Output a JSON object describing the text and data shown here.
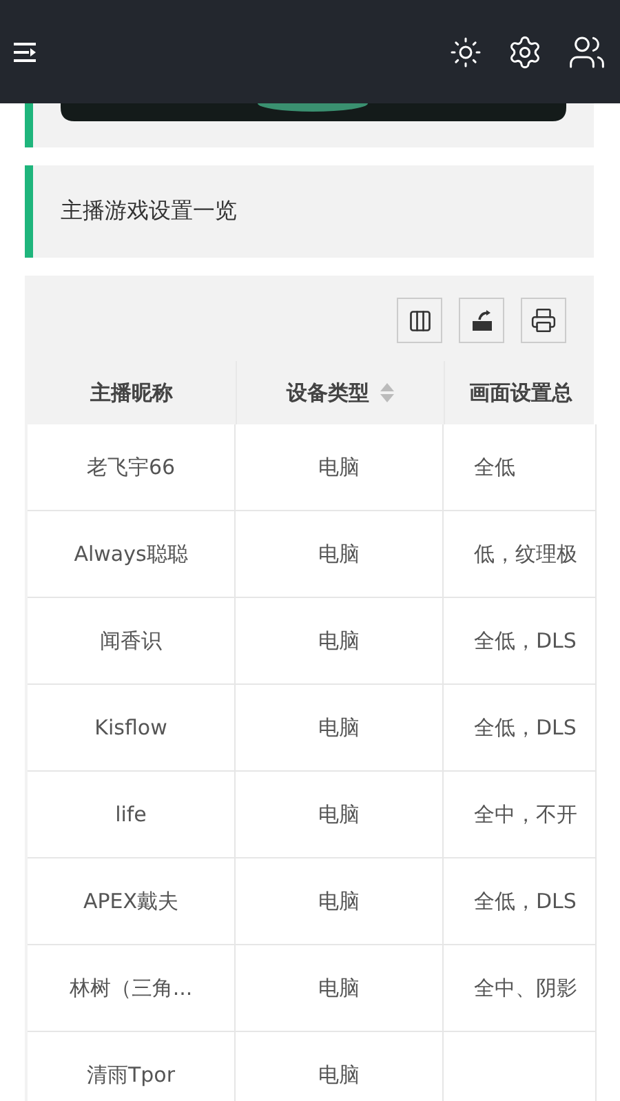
{
  "section": {
    "title": "主播游戏设置一览"
  },
  "table": {
    "columns": [
      {
        "label": "主播昵称",
        "sortable": false
      },
      {
        "label": "设备类型",
        "sortable": true
      },
      {
        "label": "画面设置总",
        "sortable": false
      }
    ],
    "rows": [
      [
        "老飞宇66",
        "电脑",
        "全低"
      ],
      [
        "Always聪聪",
        "电脑",
        "低，纹理极"
      ],
      [
        "闻香识",
        "电脑",
        "全低，DLS"
      ],
      [
        "Kisflow",
        "电脑",
        "全低，DLS"
      ],
      [
        "life",
        "电脑",
        "全中，不开"
      ],
      [
        "APEX戴夫",
        "电脑",
        "全低，DLS"
      ],
      [
        "林树（三角...",
        "电脑",
        "全中、阴影"
      ],
      [
        "清雨Tpor",
        "电脑"
      ]
    ]
  }
}
